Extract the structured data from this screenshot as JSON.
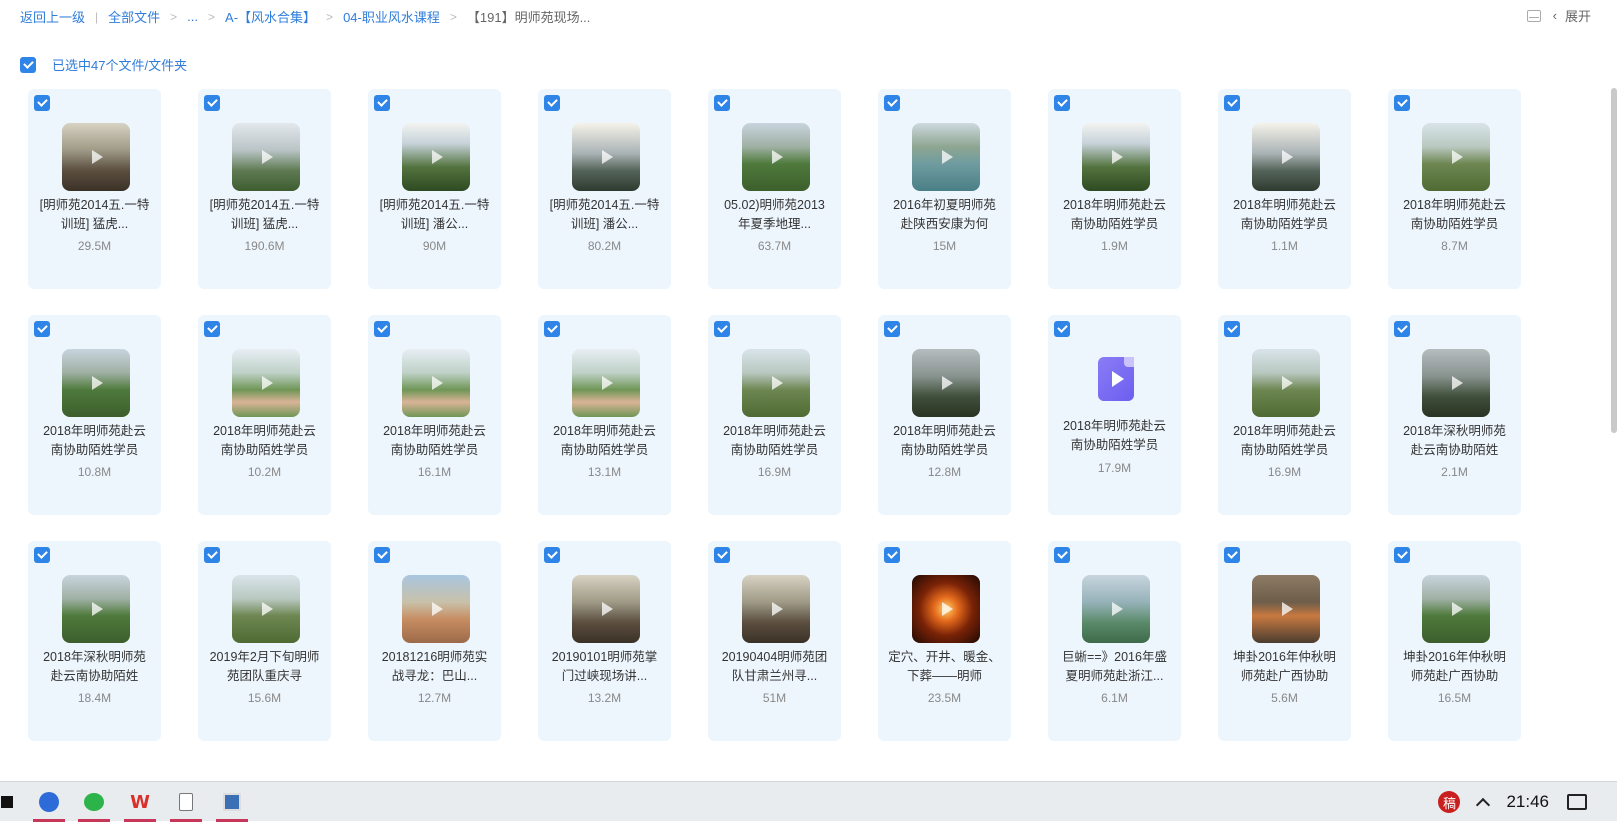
{
  "breadcrumb": {
    "back": "返回上一级",
    "all_files": "全部文件",
    "ellipsis": "...",
    "folder1": "A-【风水合集】",
    "folder2": "04-职业风水课程",
    "current": "【191】明师苑现场..."
  },
  "top_right": {
    "expand_label": "展开"
  },
  "selection": {
    "label": "已选中47个文件/文件夹"
  },
  "files": [
    {
      "name": "[明师苑2014五.一特训班] 猛虎...",
      "size": "29.5M",
      "thumb": "t-people"
    },
    {
      "name": "[明师苑2014五.一特训班] 猛虎...",
      "size": "190.6M",
      "thumb": "t-mist"
    },
    {
      "name": "[明师苑2014五.一特训班] 潘公...",
      "size": "90M",
      "thumb": "t-sky"
    },
    {
      "name": "[明师苑2014五.一特训班] 潘公...",
      "size": "80.2M",
      "thumb": "t-cloud"
    },
    {
      "name": "05.02)明师苑2013年夏季地理...",
      "size": "63.7M",
      "thumb": "t-field"
    },
    {
      "name": "2016年初夏明师苑赴陕西安康为何",
      "size": "15M",
      "thumb": "t-lake"
    },
    {
      "name": "2018年明师苑赴云南协助陌姓学员",
      "size": "1.9M",
      "thumb": "t-sky"
    },
    {
      "name": "2018年明师苑赴云南协助陌姓学员",
      "size": "1.1M",
      "thumb": "t-cloud"
    },
    {
      "name": "2018年明师苑赴云南协助陌姓学员",
      "size": "8.7M",
      "thumb": "t-hill"
    },
    {
      "name": "2018年明师苑赴云南协助陌姓学员",
      "size": "10.8M",
      "thumb": "t-field"
    },
    {
      "name": "2018年明师苑赴云南协助陌姓学员",
      "size": "10.2M",
      "thumb": "t-hand"
    },
    {
      "name": "2018年明师苑赴云南协助陌姓学员",
      "size": "16.1M",
      "thumb": "t-hand"
    },
    {
      "name": "2018年明师苑赴云南协助陌姓学员",
      "size": "13.1M",
      "thumb": "t-hand"
    },
    {
      "name": "2018年明师苑赴云南协助陌姓学员",
      "size": "16.9M",
      "thumb": "t-hill"
    },
    {
      "name": "2018年明师苑赴云南协助陌姓学员",
      "size": "12.8M",
      "thumb": "t-dark"
    },
    {
      "name": "2018年明师苑赴云南协助陌姓学员",
      "size": "17.9M",
      "thumb": "video"
    },
    {
      "name": "2018年明师苑赴云南协助陌姓学员",
      "size": "16.9M",
      "thumb": "t-hill"
    },
    {
      "name": "2018年深秋明师苑赴云南协助陌姓",
      "size": "2.1M",
      "thumb": "t-dark"
    },
    {
      "name": "2018年深秋明师苑赴云南协助陌姓",
      "size": "18.4M",
      "thumb": "t-field"
    },
    {
      "name": "2019年2月下旬明师苑团队重庆寻",
      "size": "15.6M",
      "thumb": "t-hill"
    },
    {
      "name": "20181216明师苑实战寻龙：巴山...",
      "size": "12.7M",
      "thumb": "t-red"
    },
    {
      "name": "20190101明师苑掌门过峡现场讲...",
      "size": "13.2M",
      "thumb": "t-people"
    },
    {
      "name": "20190404明师苑团队甘肃兰州寻...",
      "size": "51M",
      "thumb": "t-people"
    },
    {
      "name": "定穴、开井、暖金、下葬——明师",
      "size": "23.5M",
      "thumb": "t-fire"
    },
    {
      "name": "巨蜥==》2016年盛夏明师苑赴浙江...",
      "size": "6.1M",
      "thumb": "t-water"
    },
    {
      "name": "坤卦2016年仲秋明师苑赴广西协助",
      "size": "5.6M",
      "thumb": "t-dig"
    },
    {
      "name": "坤卦2016年仲秋明师苑赴广西协助",
      "size": "16.5M",
      "thumb": "t-field"
    }
  ],
  "taskbar": {
    "wps_label": "W",
    "ime_label": "稿",
    "clock": "21:46"
  }
}
